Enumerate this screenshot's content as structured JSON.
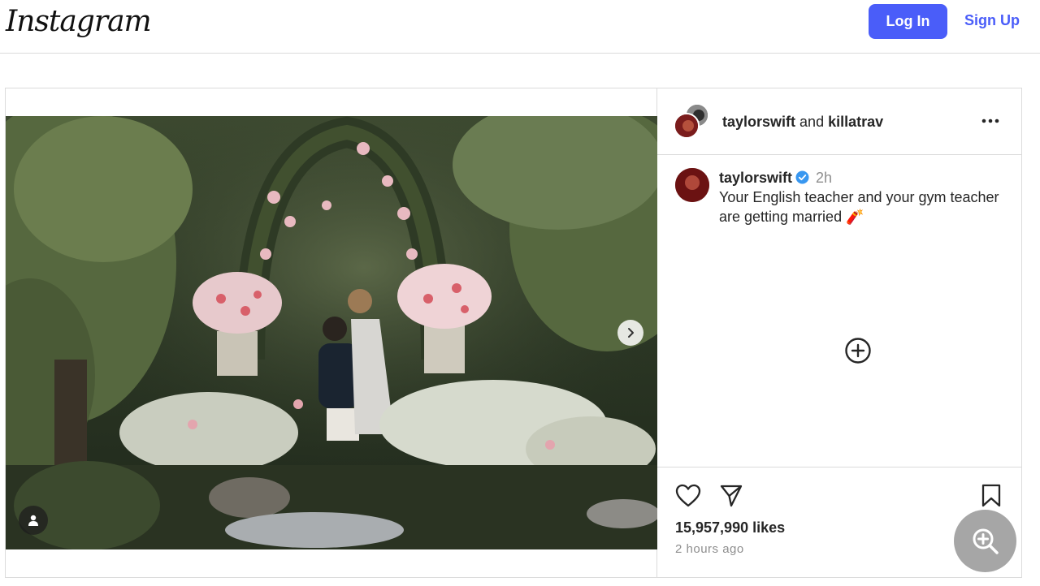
{
  "header": {
    "logo_text": "Instagram",
    "login_label": "Log In",
    "signup_label": "Sign Up",
    "accent_color": "#4a5df9"
  },
  "post": {
    "header": {
      "user1": "taylorswift",
      "conjunction": "and",
      "user2": "killatrav",
      "more_icon": "more-horizontal-icon"
    },
    "caption": {
      "username": "taylorswift",
      "verified": true,
      "time": "2h",
      "text": "Your English teacher and your gym teacher are getting married 🧨"
    },
    "media": {
      "description_icon": "photo-garden-proposal",
      "next_icon": "chevron-right-icon",
      "tag_icon": "user-tag-icon"
    },
    "actions": {
      "like_icon": "heart-icon",
      "share_icon": "send-icon",
      "save_icon": "bookmark-icon"
    },
    "likes_text": "15,957,990 likes",
    "time_ago": "2 hours ago"
  },
  "overlay": {
    "zoom_icon": "zoom-in-icon"
  }
}
